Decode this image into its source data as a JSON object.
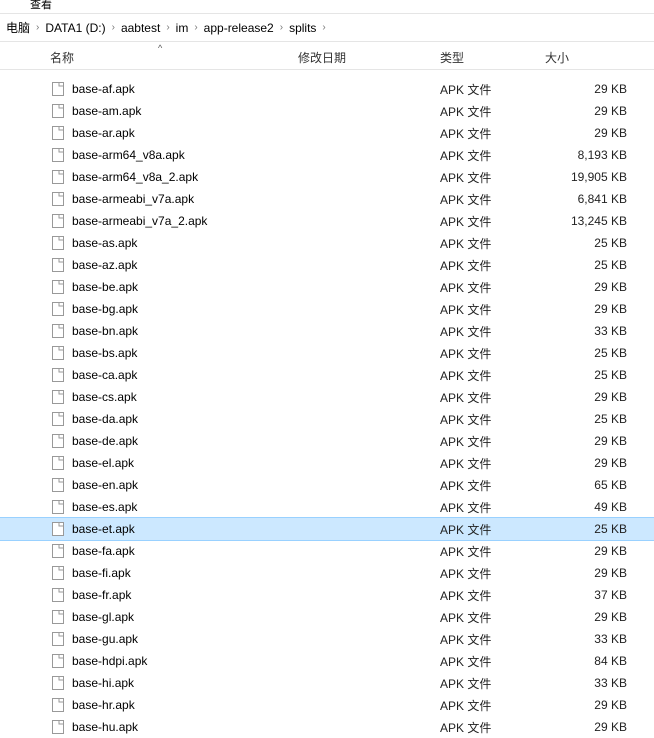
{
  "toolbar_remnant_text": "查看",
  "breadcrumb": {
    "items": [
      "电脑",
      "DATA1 (D:)",
      "aabtest",
      "im",
      "app-release2",
      "splits"
    ],
    "separator": "›"
  },
  "columns": {
    "name": "名称",
    "date": "修改日期",
    "type": "类型",
    "size": "大小",
    "sort_indicator": "^"
  },
  "file_type_label": "APK 文件",
  "selected_index": 20,
  "files": [
    {
      "name": "base-af.apk",
      "size": "29 KB"
    },
    {
      "name": "base-am.apk",
      "size": "29 KB"
    },
    {
      "name": "base-ar.apk",
      "size": "29 KB"
    },
    {
      "name": "base-arm64_v8a.apk",
      "size": "8,193 KB"
    },
    {
      "name": "base-arm64_v8a_2.apk",
      "size": "19,905 KB"
    },
    {
      "name": "base-armeabi_v7a.apk",
      "size": "6,841 KB"
    },
    {
      "name": "base-armeabi_v7a_2.apk",
      "size": "13,245 KB"
    },
    {
      "name": "base-as.apk",
      "size": "25 KB"
    },
    {
      "name": "base-az.apk",
      "size": "25 KB"
    },
    {
      "name": "base-be.apk",
      "size": "29 KB"
    },
    {
      "name": "base-bg.apk",
      "size": "29 KB"
    },
    {
      "name": "base-bn.apk",
      "size": "33 KB"
    },
    {
      "name": "base-bs.apk",
      "size": "25 KB"
    },
    {
      "name": "base-ca.apk",
      "size": "25 KB"
    },
    {
      "name": "base-cs.apk",
      "size": "29 KB"
    },
    {
      "name": "base-da.apk",
      "size": "25 KB"
    },
    {
      "name": "base-de.apk",
      "size": "29 KB"
    },
    {
      "name": "base-el.apk",
      "size": "29 KB"
    },
    {
      "name": "base-en.apk",
      "size": "65 KB"
    },
    {
      "name": "base-es.apk",
      "size": "49 KB"
    },
    {
      "name": "base-et.apk",
      "size": "25 KB"
    },
    {
      "name": "base-fa.apk",
      "size": "29 KB"
    },
    {
      "name": "base-fi.apk",
      "size": "29 KB"
    },
    {
      "name": "base-fr.apk",
      "size": "37 KB"
    },
    {
      "name": "base-gl.apk",
      "size": "29 KB"
    },
    {
      "name": "base-gu.apk",
      "size": "33 KB"
    },
    {
      "name": "base-hdpi.apk",
      "size": "84 KB"
    },
    {
      "name": "base-hi.apk",
      "size": "33 KB"
    },
    {
      "name": "base-hr.apk",
      "size": "29 KB"
    },
    {
      "name": "base-hu.apk",
      "size": "29 KB"
    }
  ]
}
